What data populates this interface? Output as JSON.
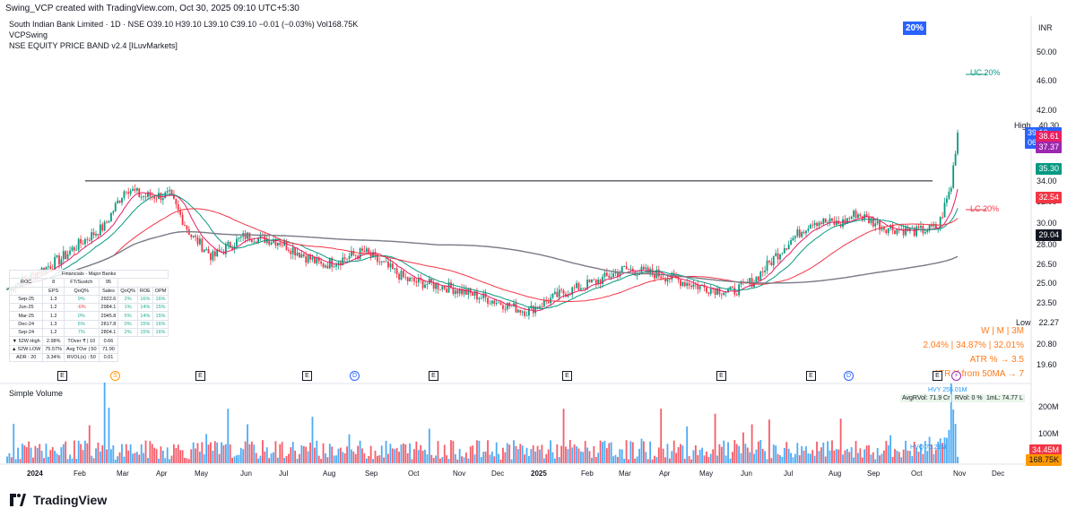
{
  "header": {
    "credit": "Swing_VCP created with TradingView.com, Oct 30, 2025 09:10 UTC+5:30"
  },
  "legend": {
    "symbol_line": "South Indian Bank Limited · 1D · NSE  O39.10  H39.10  L39.10  C39.10  −0.01 (−0.03%)  Vol168.75K",
    "indicator_1": "VCPSwing",
    "indicator_2": "NSE EQUITY PRICE BAND v2.4 [ILuvMarkets]"
  },
  "badge": {
    "pct": "20%",
    "currency": "INR"
  },
  "price_axis": {
    "ticks": [
      "50.00",
      "46.00",
      "42.00",
      "38.00",
      "34.00",
      "32.00",
      "30.00",
      "28.00",
      "26.50",
      "25.00",
      "23.50",
      "22.00",
      "20.80",
      "19.60"
    ],
    "tick_values": [
      50,
      46,
      42,
      38,
      34,
      32,
      30,
      28,
      26.5,
      25,
      23.5,
      22,
      20.8,
      19.6
    ]
  },
  "band": {
    "uc": "UC  20%",
    "lc": "LC  20%"
  },
  "high_low": {
    "high_label": "High",
    "high_value": "40.30",
    "low_label": "Low",
    "low_value": "22.27"
  },
  "price_tags": [
    {
      "value": "39.10",
      "sub": "06:19:22",
      "color": "#2962ff",
      "price": 39.1
    },
    {
      "value": "38.61",
      "sub": "",
      "color": "#e91e63",
      "price": 38.61
    },
    {
      "value": "37.37",
      "sub": "",
      "color": "#9c27b0",
      "price": 37.37
    },
    {
      "value": "35.30",
      "sub": "",
      "color": "#089981",
      "price": 35.3
    },
    {
      "value": "32.54",
      "sub": "",
      "color": "#f23645",
      "price": 32.54
    },
    {
      "value": "29.04",
      "sub": "",
      "color": "#131722",
      "price": 29.04
    }
  ],
  "stats": {
    "timeframes": "W    |    M    |    3M",
    "returns": "2.04% | 34.87% | 32.01%",
    "atr": "ATR % → 3.5",
    "atr_x": "ATR X from 50MA → 7"
  },
  "fundamentals": {
    "header": [
      "",
      "Financials - Major Banks",
      ""
    ],
    "top": [
      "ROC",
      "8",
      "FT/Sustch",
      "95"
    ],
    "cols": [
      "",
      "EPS",
      "QoQ%",
      "Sales",
      "QoQ%",
      "ROE",
      "OPM"
    ],
    "rows": [
      [
        "Sep-25",
        "1.3",
        "9%",
        "2922.6",
        "2%",
        "16%",
        "16%"
      ],
      [
        "Jun-25",
        "1.2",
        "-6%",
        "2984.1",
        "1%",
        "14%",
        "15%"
      ],
      [
        "Mar-25",
        "1.2",
        "0%",
        "2945.8",
        "5%",
        "14%",
        "15%"
      ],
      [
        "Dec-24",
        "1.3",
        "5%",
        "2817.8",
        "0%",
        "15%",
        "16%"
      ],
      [
        "Sep-24",
        "1.2",
        "7%",
        "2804.1",
        "2%",
        "15%",
        "16%"
      ]
    ],
    "extra": [
      [
        "▼ 52W High",
        "2.98%",
        "TOver ₹ | 10",
        "0.66"
      ],
      [
        "▲ 52W LOW",
        "75.57%",
        "Avg TOvr | 50",
        "71.90"
      ],
      [
        "ADR : 20",
        "3.34%",
        "RVOL(x) : 50",
        "0.01"
      ]
    ]
  },
  "events": [
    {
      "label": "E",
      "kind": "e"
    },
    {
      "label": "S",
      "kind": "s"
    },
    {
      "label": "E",
      "kind": "e"
    },
    {
      "label": "E",
      "kind": "e"
    },
    {
      "label": "D",
      "kind": "d"
    },
    {
      "label": "E",
      "kind": "e"
    },
    {
      "label": "E",
      "kind": "e"
    },
    {
      "label": "E",
      "kind": "e"
    },
    {
      "label": "E",
      "kind": "e"
    },
    {
      "label": "D",
      "kind": "d"
    },
    {
      "label": "E",
      "kind": "e"
    },
    {
      "label": "⚡",
      "kind": "z"
    }
  ],
  "volume": {
    "title": "Simple Volume",
    "hvy": "HVY 255.01M",
    "avg": "AvgRVol: 71.9 Cr",
    "rvol": "RVol: 0 %",
    "iml": "1mL: 74.77 L",
    "hvq": "HVQ 75.21M",
    "axis_200m": "200M",
    "axis_100m": "100M",
    "tag_1": "34.45M",
    "tag_2": "168.75K"
  },
  "time_axis": [
    "2024",
    "Feb",
    "Mar",
    "Apr",
    "May",
    "Jun",
    "Jul",
    "Aug",
    "Sep",
    "Oct",
    "Nov",
    "Dec",
    "2025",
    "Feb",
    "Mar",
    "Apr",
    "May",
    "Jun",
    "Jul",
    "Aug",
    "Sep",
    "Oct",
    "Nov",
    "Dec"
  ],
  "brand": "TradingView",
  "colors": {
    "up": "#089981",
    "down": "#f23645",
    "vol_up": "#2196f3",
    "vol_down": "#f23645",
    "ma_fast": "#e91e63",
    "ma_mid": "#089981",
    "ma_slow": "#f23645",
    "ma_long": "#787b86"
  }
}
